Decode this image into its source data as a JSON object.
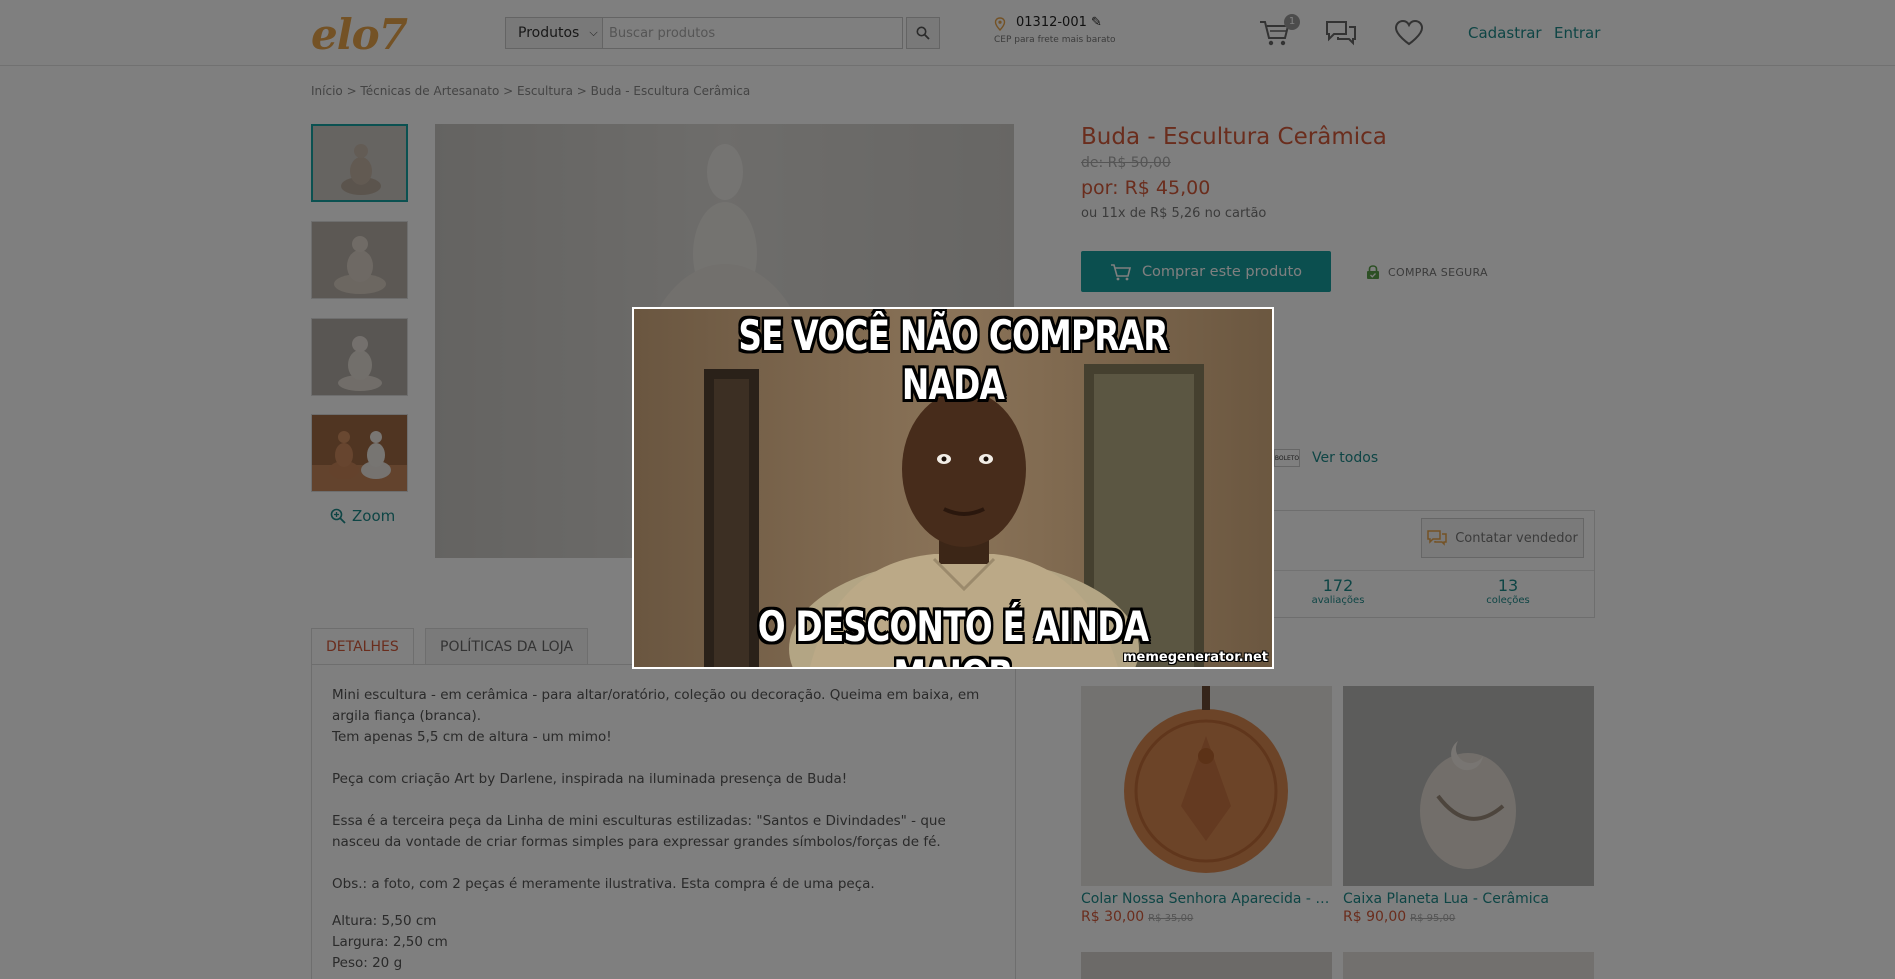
{
  "header": {
    "logo": "elo7",
    "category_label": "Produtos",
    "search_placeholder": "Buscar produtos",
    "cep_code": "01312-001",
    "cep_hint": "CEP para frete mais barato",
    "cart_count": "1",
    "register_label": "Cadastrar",
    "login_label": "Entrar"
  },
  "breadcrumb": {
    "text": "Início > Técnicas de Artesanato > Escultura > Buda - Escultura Cerâmica"
  },
  "gallery": {
    "zoom_label": "Zoom"
  },
  "tabs": [
    {
      "label": "DETALHES"
    },
    {
      "label": "POLÍTICAS DA LOJA"
    }
  ],
  "details": {
    "lines": [
      "Mini escultura - em cerâmica - para altar/oratório, coleção ou decoração. Queima em baixa, em argila fiança (branca).",
      "Tem apenas 5,5 cm de altura - um mimo!",
      "Peça com criação Art by Darlene, inspirada na iluminada presença de Buda!",
      "Essa é a terceira peça da Linha de mini esculturas estilizadas: \"Santos e Divindades\" - que nasceu da vontade de criar formas simples para expressar grandes símbolos/forças de fé.",
      "Obs.: a foto, com 2 peças é meramente ilustrativa. Esta compra é de uma peça."
    ],
    "specs": [
      "Altura: 5,50 cm",
      "Largura: 2,50 cm",
      "Peso: 20 g"
    ]
  },
  "product": {
    "title": "Buda - Escultura Cerâmica",
    "old_price": "de: R$ 50,00",
    "price": "por: R$ 45,00",
    "installments": "ou 11x de R$ 5,26 no cartão",
    "buy_label": "Comprar este produto",
    "secure_label": "COMPRA SEGURA",
    "see_all_label": "Ver todos",
    "boleto_label": "BOLETO"
  },
  "seller": {
    "contact_label": "Contatar vendedor",
    "stats": [
      {
        "num": "172",
        "label": "avaliações"
      },
      {
        "num": "13",
        "label": "coleções"
      }
    ]
  },
  "related": [
    {
      "title": "Colar Nossa Senhora Aparecida - Ce...",
      "price": "R$ 30,00",
      "old_price": "R$ 35,00"
    },
    {
      "title": "Caixa Planeta Lua - Cerâmica",
      "price": "R$ 90,00",
      "old_price": "R$ 95,00"
    }
  ],
  "meme": {
    "top_text": "SE VOCÊ NÃO COMPRAR NADA",
    "bottom_text": "O DESCONTO É AINDA MAIOR",
    "watermark": "memegenerator.net"
  },
  "colors": {
    "accent": "#169e9e",
    "price": "#d45a3a",
    "logo": "#e8a44b"
  }
}
